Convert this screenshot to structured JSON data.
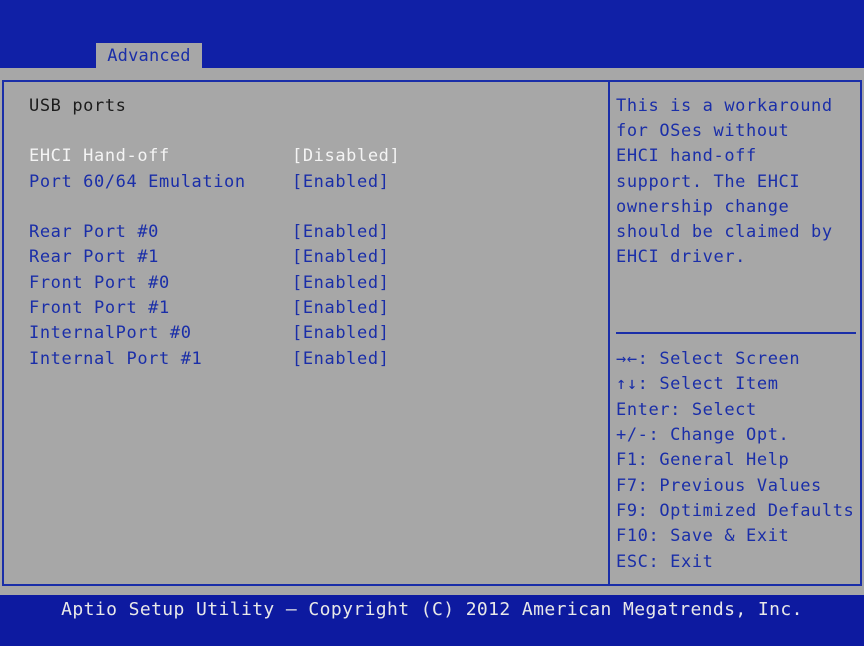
{
  "header": {
    "active_tab": "Advanced"
  },
  "section": {
    "title": "USB ports"
  },
  "settings": [
    {
      "label": "EHCI Hand-off",
      "value": "[Disabled]"
    },
    {
      "label": "Port 60/64 Emulation",
      "value": "[Enabled]"
    },
    {
      "label": "Rear Port #0",
      "value": "[Enabled]"
    },
    {
      "label": "Rear Port #1",
      "value": "[Enabled]"
    },
    {
      "label": "Front Port #0",
      "value": "[Enabled]"
    },
    {
      "label": "Front Port #1",
      "value": "[Enabled]"
    },
    {
      "label": "InternalPort #0",
      "value": "[Enabled]"
    },
    {
      "label": "Internal Port #1",
      "value": "[Enabled]"
    }
  ],
  "help": {
    "description": [
      "This is a workaround",
      "for OSes without",
      "EHCI hand-off",
      "support. The EHCI",
      "ownership change",
      "should be claimed by",
      "EHCI driver."
    ],
    "keys": [
      "→←: Select Screen",
      "↑↓: Select Item",
      "Enter: Select",
      "+/-: Change Opt.",
      "F1: General Help",
      "F7: Previous Values",
      "F9: Optimized Defaults",
      "F10: Save & Exit",
      "ESC: Exit"
    ]
  },
  "footer": {
    "text": "Aptio Setup Utility – Copyright (C) 2012 American Megatrends, Inc."
  },
  "colors": {
    "background_blue": "#0d1aa0",
    "panel_gray": "#a7a7a7",
    "accent_blue": "#1a2ea8",
    "highlight_white": "#f4f4f4"
  }
}
